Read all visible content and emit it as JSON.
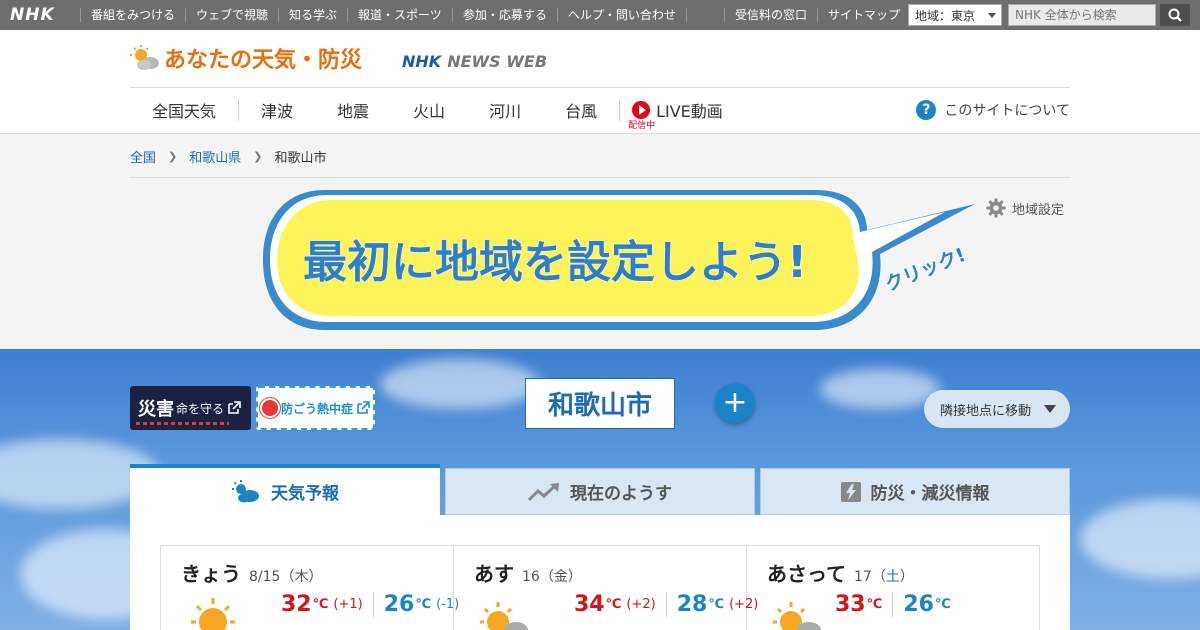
{
  "topbar": {
    "logo": "NHK",
    "nav": [
      "番組をみつける",
      "ウェブで視聴",
      "知る学ぶ",
      "報道・スポーツ",
      "参加・応募する",
      "ヘルプ・問い合わせ"
    ],
    "right_links": [
      "受信料の窓口",
      "サイトマップ"
    ],
    "region_select": "地域：東京",
    "search_placeholder": "NHK 全体から検索",
    "bg_color": "#6e6e6e"
  },
  "header": {
    "brand_title": "あなたの天気・防災",
    "partner_logo_a": "NHK",
    "partner_logo_b": "NEWS WEB",
    "nav": {
      "national": "全国天気",
      "tsunami": "津波",
      "earthquake": "地震",
      "volcano": "火山",
      "river": "河川",
      "typhoon": "台風",
      "live": "LIVE動画",
      "live_sub": "配信中"
    },
    "about": "このサイトについて",
    "accent_color": "#ea6d0f"
  },
  "breadcrumb": [
    "全国",
    "和歌山県",
    "和歌山市"
  ],
  "banner": {
    "message": "最初に地域を設定しよう!",
    "click": "クリック!",
    "region_setting": "地域設定"
  },
  "sky": {
    "badge_saigai_big": "災害",
    "badge_saigai_small": "命を守る",
    "badge_heat": "防ごう熱中症",
    "city": "和歌山市",
    "add_label": "+",
    "nearby": "隣接地点に移動"
  },
  "tabs": {
    "forecast": "天気予報",
    "now": "現在のようす",
    "bousai": "防災・減災情報"
  },
  "forecast": [
    {
      "name": "きょう",
      "date_main": "8/15",
      "weekday": "（木）",
      "hi": "32",
      "hi_diff": "(+1)",
      "lo": "26",
      "lo_diff": "(-1)",
      "unit": "℃"
    },
    {
      "name": "あす",
      "date_main": "16",
      "weekday": "（金）",
      "hi": "34",
      "hi_diff": "(+2)",
      "lo": "28",
      "lo_diff": "(+2)",
      "unit": "℃"
    },
    {
      "name": "あさって",
      "date_main": "17",
      "weekday_open": "（",
      "weekday": "土",
      "weekday_close": "）",
      "hi": "33",
      "lo": "26",
      "unit": "℃"
    }
  ]
}
